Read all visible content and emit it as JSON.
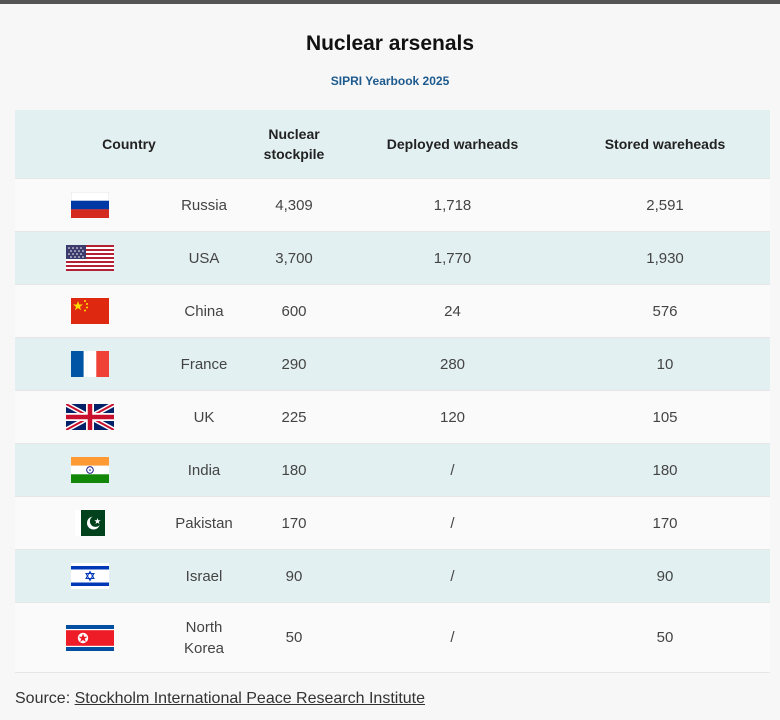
{
  "title": "Nuclear arsenals",
  "subtitle": "SIPRI Yearbook 2025",
  "table": {
    "headers": {
      "country": "Country",
      "stockpile_l1": "Nuclear",
      "stockpile_l2": "stockpile",
      "deployed": "Deployed warheads",
      "stored": "Stored wareheads"
    },
    "rows": [
      {
        "flag": "russia-flag-icon",
        "country": "Russia",
        "stockpile": "4,309",
        "deployed": "1,718",
        "stored": "2,591"
      },
      {
        "flag": "usa-flag-icon",
        "country": "USA",
        "stockpile": "3,700",
        "deployed": "1,770",
        "stored": "1,930"
      },
      {
        "flag": "china-flag-icon",
        "country": "China",
        "stockpile": "600",
        "deployed": "24",
        "stored": "576"
      },
      {
        "flag": "france-flag-icon",
        "country": "France",
        "stockpile": "290",
        "deployed": "280",
        "stored": "10"
      },
      {
        "flag": "uk-flag-icon",
        "country": "UK",
        "stockpile": "225",
        "deployed": "120",
        "stored": "105"
      },
      {
        "flag": "india-flag-icon",
        "country": "India",
        "stockpile": "180",
        "deployed": "/",
        "stored": "180"
      },
      {
        "flag": "pakistan-flag-icon",
        "country": "Pakistan",
        "stockpile": "170",
        "deployed": "/",
        "stored": "170"
      },
      {
        "flag": "israel-flag-icon",
        "country": "Israel",
        "stockpile": "90",
        "deployed": "/",
        "stored": "90"
      },
      {
        "flag": "north-korea-flag-icon",
        "country_l1": "North",
        "country_l2": "Korea",
        "stockpile": "50",
        "deployed": "/",
        "stored": "50"
      }
    ]
  },
  "source": {
    "prefix": "Source:",
    "link_text": "Stockholm International Peace Research Institute"
  },
  "chart_data": {
    "type": "table",
    "title": "Nuclear arsenals",
    "subtitle": "SIPRI Yearbook 2025",
    "columns": [
      "Country",
      "Nuclear stockpile",
      "Deployed warheads",
      "Stored wareheads"
    ],
    "categories": [
      "Russia",
      "USA",
      "China",
      "France",
      "UK",
      "India",
      "Pakistan",
      "Israel",
      "North Korea"
    ],
    "series": [
      {
        "name": "Nuclear stockpile",
        "values": [
          4309,
          3700,
          600,
          290,
          225,
          180,
          170,
          90,
          50
        ]
      },
      {
        "name": "Deployed warheads",
        "values": [
          1718,
          1770,
          24,
          280,
          120,
          null,
          null,
          null,
          null
        ]
      },
      {
        "name": "Stored wareheads",
        "values": [
          2591,
          1930,
          576,
          10,
          105,
          180,
          170,
          90,
          50
        ]
      }
    ]
  }
}
